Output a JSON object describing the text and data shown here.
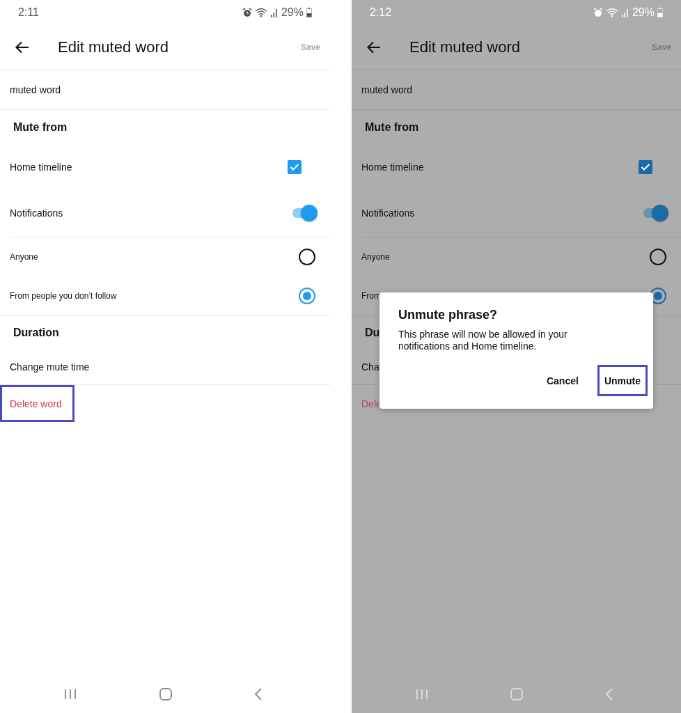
{
  "screens": [
    {
      "dimmed": false,
      "status_bar": {
        "time": "2:11",
        "battery": "29%"
      },
      "header": {
        "title": "Edit muted word",
        "save": {
          "label": "Save",
          "disabled": true
        }
      },
      "word": "muted word",
      "sections": [
        {
          "title": "Mute from",
          "rows": [
            {
              "kind": "checkbox",
              "label": "Home timeline",
              "checked": true
            },
            {
              "kind": "toggle",
              "label": "Notifications",
              "on": true,
              "divider": true
            },
            {
              "kind": "radio",
              "label": "Anyone",
              "selected": false
            },
            {
              "kind": "radio",
              "label": "From people you don’t follow",
              "selected": true
            }
          ]
        },
        {
          "title": "Duration",
          "rows": [
            {
              "kind": "link",
              "label": "Change mute time"
            }
          ]
        }
      ],
      "delete": {
        "label": "Delete word",
        "highlighted": true
      }
    },
    {
      "dimmed": true,
      "status_bar": {
        "time": "2:12",
        "battery": "29%"
      },
      "header": {
        "title": "Edit muted word",
        "save": {
          "label": "Save",
          "disabled": true
        }
      },
      "word": "muted word",
      "sections": [
        {
          "title": "Mute from",
          "rows": [
            {
              "kind": "checkbox",
              "label": "Home timeline",
              "checked": true
            },
            {
              "kind": "toggle",
              "label": "Notifications",
              "on": true,
              "divider": true
            },
            {
              "kind": "radio",
              "label": "Anyone",
              "selected": false
            },
            {
              "kind": "radio",
              "label": "From",
              "selected": true
            }
          ]
        },
        {
          "title": "Du",
          "rows": [
            {
              "kind": "link",
              "label": "Cha"
            }
          ]
        }
      ],
      "delete": {
        "label": "Dele",
        "highlighted": false
      },
      "dialog": {
        "title": "Unmute phrase?",
        "message": "This phrase will now be allowed in your notifications and Home timeline.",
        "buttons": [
          {
            "label": "Cancel",
            "highlighted": false
          },
          {
            "label": "Unmute",
            "highlighted": true
          }
        ]
      }
    }
  ]
}
